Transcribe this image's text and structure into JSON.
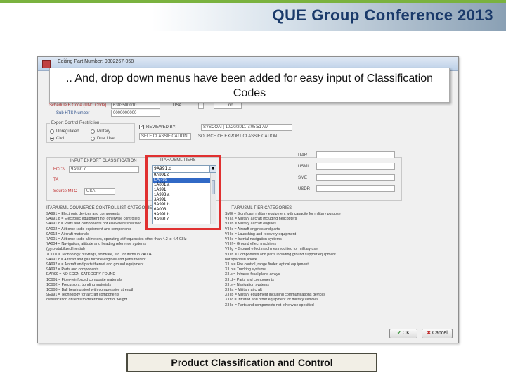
{
  "slide": {
    "header_title": "QUE Group Conference 2013",
    "callout_text": ".. And, drop down menus have been added for easy input of Classification Codes",
    "caption": "Product Classification and Control"
  },
  "window": {
    "title": "Editing Part Number: 9302267-058",
    "top_fields": {
      "schedule_b_label": "Schedule B Code (UNC Code)",
      "schedule_b_value": "6303500010",
      "hts_label": "Sub HTS Number",
      "hts_value": "0000000000",
      "usa_label": "USA",
      "usa_value": "no"
    },
    "reg_group": {
      "label": "Export Control Restriction",
      "options": [
        "Unregulated",
        "Military",
        "Civil",
        "Dual Use"
      ],
      "selected": "Civil"
    },
    "review_checkbox": "REVIEWED BY:",
    "review_value": "SYSCOAI | 10/20/2011 7:05:51 AM",
    "self_classification": "SELF CLASSIFICATION",
    "source_classification": "SOURCE OF EXPORT CLASSIFICATION",
    "eccn_heading": "INPUT EXPORT CLASSIFICATION",
    "eccn_label": "ECCN",
    "eccn_value": "9A991.d",
    "ta_label": "TA",
    "source_mtc_label": "Source MTC",
    "source_mtc_value": "USA",
    "dropdown": {
      "heading": "ITAR/USML TIERS",
      "selected": "9A991.d",
      "items": [
        "9A991.d",
        "EAR99",
        "1A001.a",
        "1A991",
        "1A993.a",
        "3A991",
        "5A991.b",
        "6A003",
        "9A991.b",
        "9A991.c"
      ],
      "highlighted": "EAR99"
    },
    "right_fields": {
      "itar_label": "ITAR",
      "usml_label": "USML",
      "sme_label": "SME",
      "usdr_label": "USDR"
    },
    "left_list_heading": "ITAR/USML COMMERCE CONTROL LIST CATEGORIES",
    "left_list": [
      "9A991 = Electronic devices and components",
      "9A991.d = Electronic equipment not otherwise controlled",
      "9A991.c = Parts and components not elsewhere specified",
      "0A002 = Airborne radio equipment and components",
      "9A018 = Aircraft materials",
      "7A001 = Airborne radio altimeters, operating at frequencies other than 4.2 to 4.4 GHz",
      "7A004 = Navigation, attitude and heading reference systems",
      "        (gyro-stabilized/inertial)",
      "7D001 = Technology drawings, software, etc. for items in 7A004",
      "9A991.c = Aircraft and gas turbine engines and parts thereof",
      "9A992.a = Aircraft and parts thereof and ground equipment",
      "9A992 = Parts and components",
      "EAR99 = NO ECCN CATEGORY FOUND",
      "1C991 = Fiber-reinforced composite materials",
      "1C992 = Precursors, bonding materials",
      "1C993 = Ball bearing steel with compressive strength",
      "9E991 = Technology for aircraft components",
      "        classification of items to determine control weight"
    ],
    "right_list_heading": "ITAR/USML TIER CATEGORIES",
    "right_list": [
      "SME = Significant military equipment with capacity for military purpose",
      "VIII.a = Military aircraft including helicopters",
      "VIII.b = Military aircraft engines",
      "VIII.c = Aircraft engines and parts",
      "VIII.d = Launching and recovery equipment",
      "VIII.e = Inertial navigation systems",
      "VIII.f = Ground effect machines",
      "VIII.g = Ground effect machines modified for military use",
      "VIII.h = Components and parts including ground support equipment",
      "        not specified above",
      "XII.a = Fire control, range finder, optical equipment",
      "XII.b = Tracking systems",
      "XII.c = Infrared focal plane arrays",
      "XII.d = Parts and components",
      "XII.e = Navigation systems",
      "XIII.a = Military aircraft",
      "XIII.b = Military equipment including communications devices",
      "XIII.c = Infrared and other equipment for military vehicles",
      "XIII.d = Parts and components not otherwise specified"
    ],
    "ok_label": "OK",
    "cancel_label": "Cancel"
  }
}
